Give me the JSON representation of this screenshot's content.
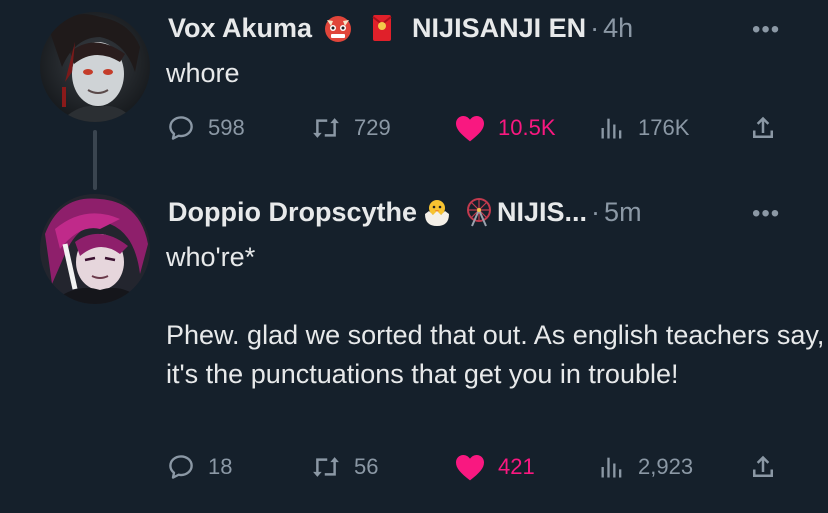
{
  "tweets": [
    {
      "author": "Vox Akuma",
      "affiliation": "NIJISANJI EN",
      "time": "4h",
      "text": "whore",
      "badges": [
        "oni-mask-emoji",
        "red-envelope-emoji"
      ],
      "stats": {
        "replies": "598",
        "retweets": "729",
        "likes": "10.5K",
        "views": "176K"
      },
      "liked": true
    },
    {
      "author": "Doppio Dropscythe",
      "affiliation": "NIJIS...",
      "time": "5m",
      "text": "who're*\n\nPhew. glad we sorted that out. As english teachers say, it's the punctuations that get you in trouble!",
      "badges": [
        "hatching-chick-emoji",
        "ferris-wheel-emoji"
      ],
      "stats": {
        "replies": "18",
        "retweets": "56",
        "likes": "421",
        "views": "2,923"
      },
      "liked": true
    }
  ],
  "ui": {
    "dot": "·",
    "more": "•••"
  },
  "colors": {
    "background": "#15202b",
    "like": "#f91880",
    "muted": "#8b98a5",
    "text": "#e7e9ea"
  }
}
